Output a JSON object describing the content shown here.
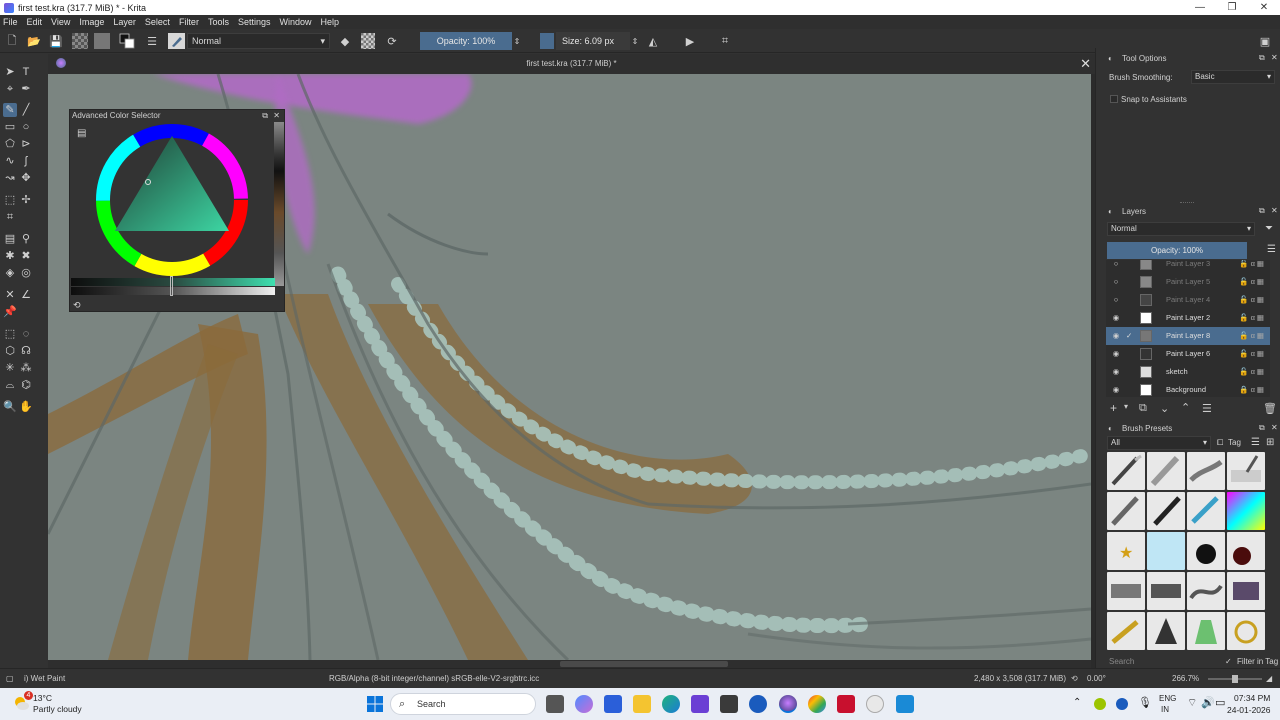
{
  "window": {
    "title": "first test.kra (317.7 MiB) * - Krita",
    "controls": [
      "—",
      "❐",
      "✕"
    ]
  },
  "menu": [
    "File",
    "Edit",
    "View",
    "Image",
    "Layer",
    "Select",
    "Filter",
    "Tools",
    "Settings",
    "Window",
    "Help"
  ],
  "toolbar": {
    "blend_mode": "Normal",
    "opacity_label": "Opacity: 100%",
    "size_label": "Size: 6.09 px"
  },
  "document": {
    "tab_title": "first test.kra (317.7 MiB) *"
  },
  "color_selector": {
    "title": "Advanced Color Selector"
  },
  "tool_options": {
    "title": "Tool Options",
    "smoothing_label": "Brush Smoothing:",
    "smoothing_value": "Basic",
    "snap_label": "Snap to Assistants"
  },
  "layers": {
    "title": "Layers",
    "blend_mode": "Normal",
    "opacity_label": "Opacity: 100%",
    "items": [
      {
        "name": "Paint Layer 3",
        "visible": false
      },
      {
        "name": "Paint Layer 5",
        "visible": false
      },
      {
        "name": "Paint Layer 4",
        "visible": false
      },
      {
        "name": "Paint Layer 2",
        "visible": true
      },
      {
        "name": "Paint Layer 8",
        "visible": true,
        "selected": true
      },
      {
        "name": "Paint Layer 6",
        "visible": true
      },
      {
        "name": "sketch",
        "visible": true
      },
      {
        "name": "Background",
        "visible": true,
        "locked": true
      }
    ]
  },
  "brush_presets": {
    "title": "Brush Presets",
    "filter_value": "All",
    "tag_label": "Tag",
    "search_placeholder": "Search",
    "filter_in_tag": "Filter in Tag"
  },
  "status": {
    "brush_name": "i) Wet Paint",
    "color_space": "RGB/Alpha (8-bit integer/channel)  sRGB-elle-V2-srgbtrc.icc",
    "image_info": "2,480 x 3,508 (317.7 MiB)",
    "rotation": "0.00°",
    "zoom": "266.7%"
  },
  "taskbar": {
    "weather_temp": "13°C",
    "weather_desc": "Partly cloudy",
    "weather_badge": "4",
    "search_label": "Search",
    "lang_top": "ENG",
    "lang_bottom": "IN",
    "time": "07:34 PM",
    "date": "24-01-2026"
  },
  "colors": {
    "accent": "#4a6c8f",
    "canvas_bg": "#7b8581",
    "panel_bg": "#323232"
  }
}
